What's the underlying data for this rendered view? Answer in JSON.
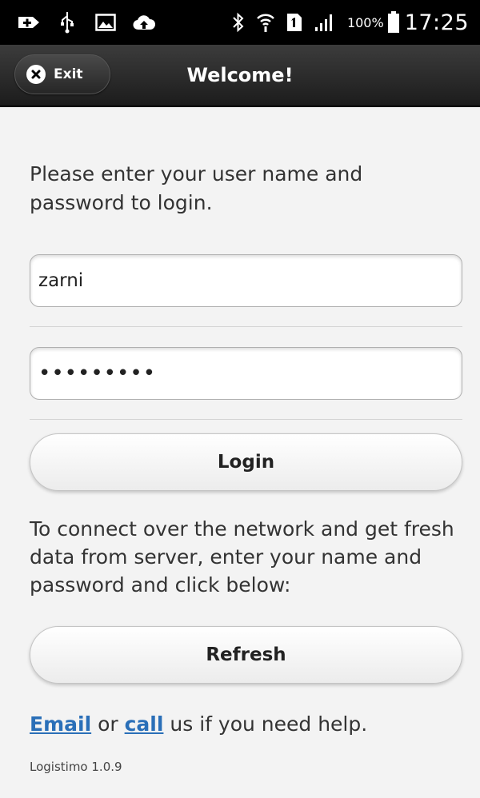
{
  "statusbar": {
    "battery_text": "100%",
    "time": "17:25",
    "icons": [
      "plus-badge-icon",
      "usb-icon",
      "image-icon",
      "cloud-upload-icon",
      "bluetooth-icon",
      "wifi-icon",
      "sim-icon",
      "signal-icon",
      "battery-icon"
    ]
  },
  "header": {
    "exit_label": "Exit",
    "title": "Welcome!"
  },
  "login": {
    "intro": "Please enter your user name and password to login.",
    "username_value": "zarni",
    "password_mask": "•••••••••",
    "login_label": "Login"
  },
  "refresh": {
    "text": "To connect over the network and get fresh data from server, enter your name and password and click below:",
    "button_label": "Refresh"
  },
  "help": {
    "email_link": "Email",
    "or_text": " or ",
    "call_link": "call",
    "suffix": " us if you need help."
  },
  "version": "Logistimo 1.0.9",
  "colors": {
    "link": "#2a6fb8",
    "header": "#1c1c1c"
  }
}
